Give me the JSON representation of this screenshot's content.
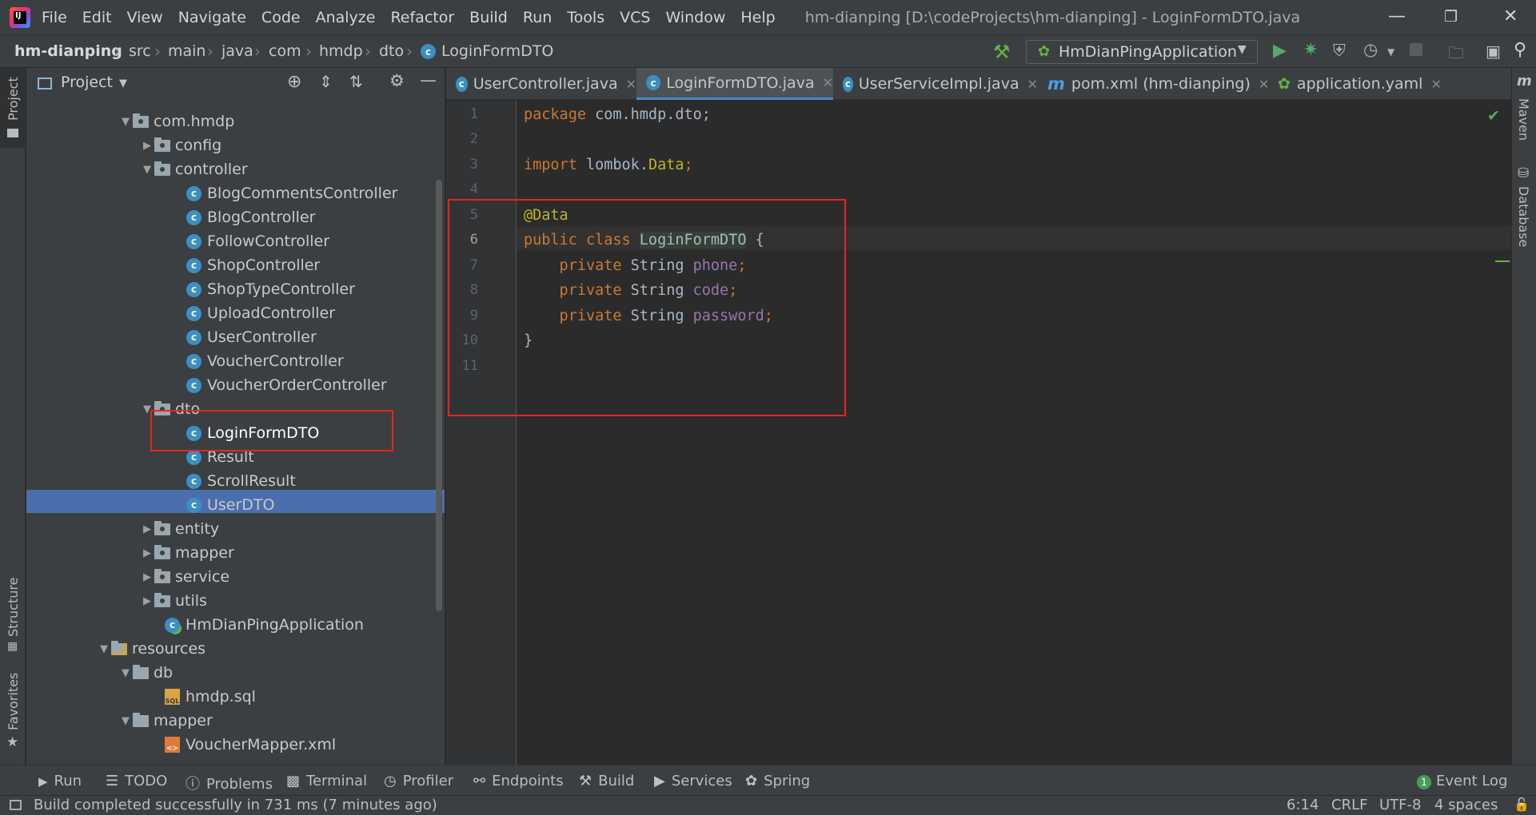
{
  "menu": [
    "File",
    "Edit",
    "View",
    "Navigate",
    "Code",
    "Analyze",
    "Refactor",
    "Build",
    "Run",
    "Tools",
    "VCS",
    "Window",
    "Help"
  ],
  "window_title": "hm-dianping [D:\\codeProjects\\hm-dianping] - LoginFormDTO.java",
  "breadcrumbs": [
    "hm-dianping",
    "src",
    "main",
    "java",
    "com",
    "hmdp",
    "dto",
    "LoginFormDTO"
  ],
  "run_config": "HmDianPingApplication",
  "project_panel": {
    "title": "Project",
    "tree": [
      {
        "label": "com.hmdp",
        "kind": "package",
        "arrow": "open"
      },
      {
        "label": "config",
        "kind": "package",
        "arrow": "closed"
      },
      {
        "label": "controller",
        "kind": "package",
        "arrow": "open"
      },
      {
        "label": "BlogCommentsController",
        "kind": "class"
      },
      {
        "label": "BlogController",
        "kind": "class"
      },
      {
        "label": "FollowController",
        "kind": "class"
      },
      {
        "label": "ShopController",
        "kind": "class"
      },
      {
        "label": "ShopTypeController",
        "kind": "class"
      },
      {
        "label": "UploadController",
        "kind": "class"
      },
      {
        "label": "UserController",
        "kind": "class"
      },
      {
        "label": "VoucherController",
        "kind": "class"
      },
      {
        "label": "VoucherOrderController",
        "kind": "class"
      },
      {
        "label": "dto",
        "kind": "package",
        "arrow": "open"
      },
      {
        "label": "LoginFormDTO",
        "kind": "class",
        "selected": true
      },
      {
        "label": "Result",
        "kind": "class"
      },
      {
        "label": "ScrollResult",
        "kind": "class"
      },
      {
        "label": "UserDTO",
        "kind": "class"
      },
      {
        "label": "entity",
        "kind": "package",
        "arrow": "closed"
      },
      {
        "label": "mapper",
        "kind": "package",
        "arrow": "closed"
      },
      {
        "label": "service",
        "kind": "package",
        "arrow": "closed"
      },
      {
        "label": "utils",
        "kind": "package",
        "arrow": "closed"
      },
      {
        "label": "HmDianPingApplication",
        "kind": "spring-class"
      },
      {
        "label": "resources",
        "kind": "folder",
        "arrow": "open"
      },
      {
        "label": "db",
        "kind": "folder",
        "arrow": "open"
      },
      {
        "label": "hmdp.sql",
        "kind": "sql"
      },
      {
        "label": "mapper",
        "kind": "folder",
        "arrow": "open"
      },
      {
        "label": "VoucherMapper.xml",
        "kind": "xml"
      }
    ]
  },
  "editor_tabs": [
    {
      "label": "UserController.java",
      "icon": "class-icon",
      "active": false
    },
    {
      "label": "LoginFormDTO.java",
      "icon": "class-icon",
      "active": true
    },
    {
      "label": "UserServiceImpl.java",
      "icon": "class-icon",
      "active": false
    },
    {
      "label": "pom.xml (hm-dianping)",
      "icon": "maven-icon",
      "active": false
    },
    {
      "label": "application.yaml",
      "icon": "spring-icon",
      "active": false
    }
  ],
  "code_lines": [
    "1",
    "2",
    "3",
    "4",
    "5",
    "6",
    "7",
    "8",
    "9",
    "10",
    "11"
  ],
  "code": {
    "l1_kw": "package",
    "l1_rest": " com.hmdp.dto;",
    "l3_kw": "import",
    "l3_pkg": " lombok.",
    "l3_ann": "Data",
    "l3_end": ";",
    "l5_ann": "@Data",
    "l6_kw": "public class ",
    "l6_name": "LoginFormDTO",
    "l6_end": " {",
    "l7_kw": "    private ",
    "l7_type": "String ",
    "l7_field": "phone",
    "l8_kw": "    private ",
    "l8_type": "String ",
    "l8_field": "code",
    "l9_kw": "    private ",
    "l9_type": "String ",
    "l9_field": "password",
    "semi": ";",
    "l10": "}"
  },
  "right_tabs": [
    "Maven",
    "Database"
  ],
  "left_tabs": [
    "Project",
    "Structure",
    "Favorites"
  ],
  "bottom_tools": [
    "Run",
    "TODO",
    "Problems",
    "Terminal",
    "Profiler",
    "Endpoints",
    "Build",
    "Services",
    "Spring"
  ],
  "event_log": {
    "count": "1",
    "label": "Event Log"
  },
  "status": {
    "message": "Build completed successfully in 731 ms (7 minutes ago)",
    "position": "6:14",
    "line_sep": "CRLF",
    "encoding": "UTF-8",
    "indent": "4 spaces"
  },
  "colors": {
    "highlight": "#e8251d",
    "selection": "#4b6eaf",
    "keyword": "#cc7832",
    "annotation": "#bbb529",
    "field": "#9876aa"
  }
}
